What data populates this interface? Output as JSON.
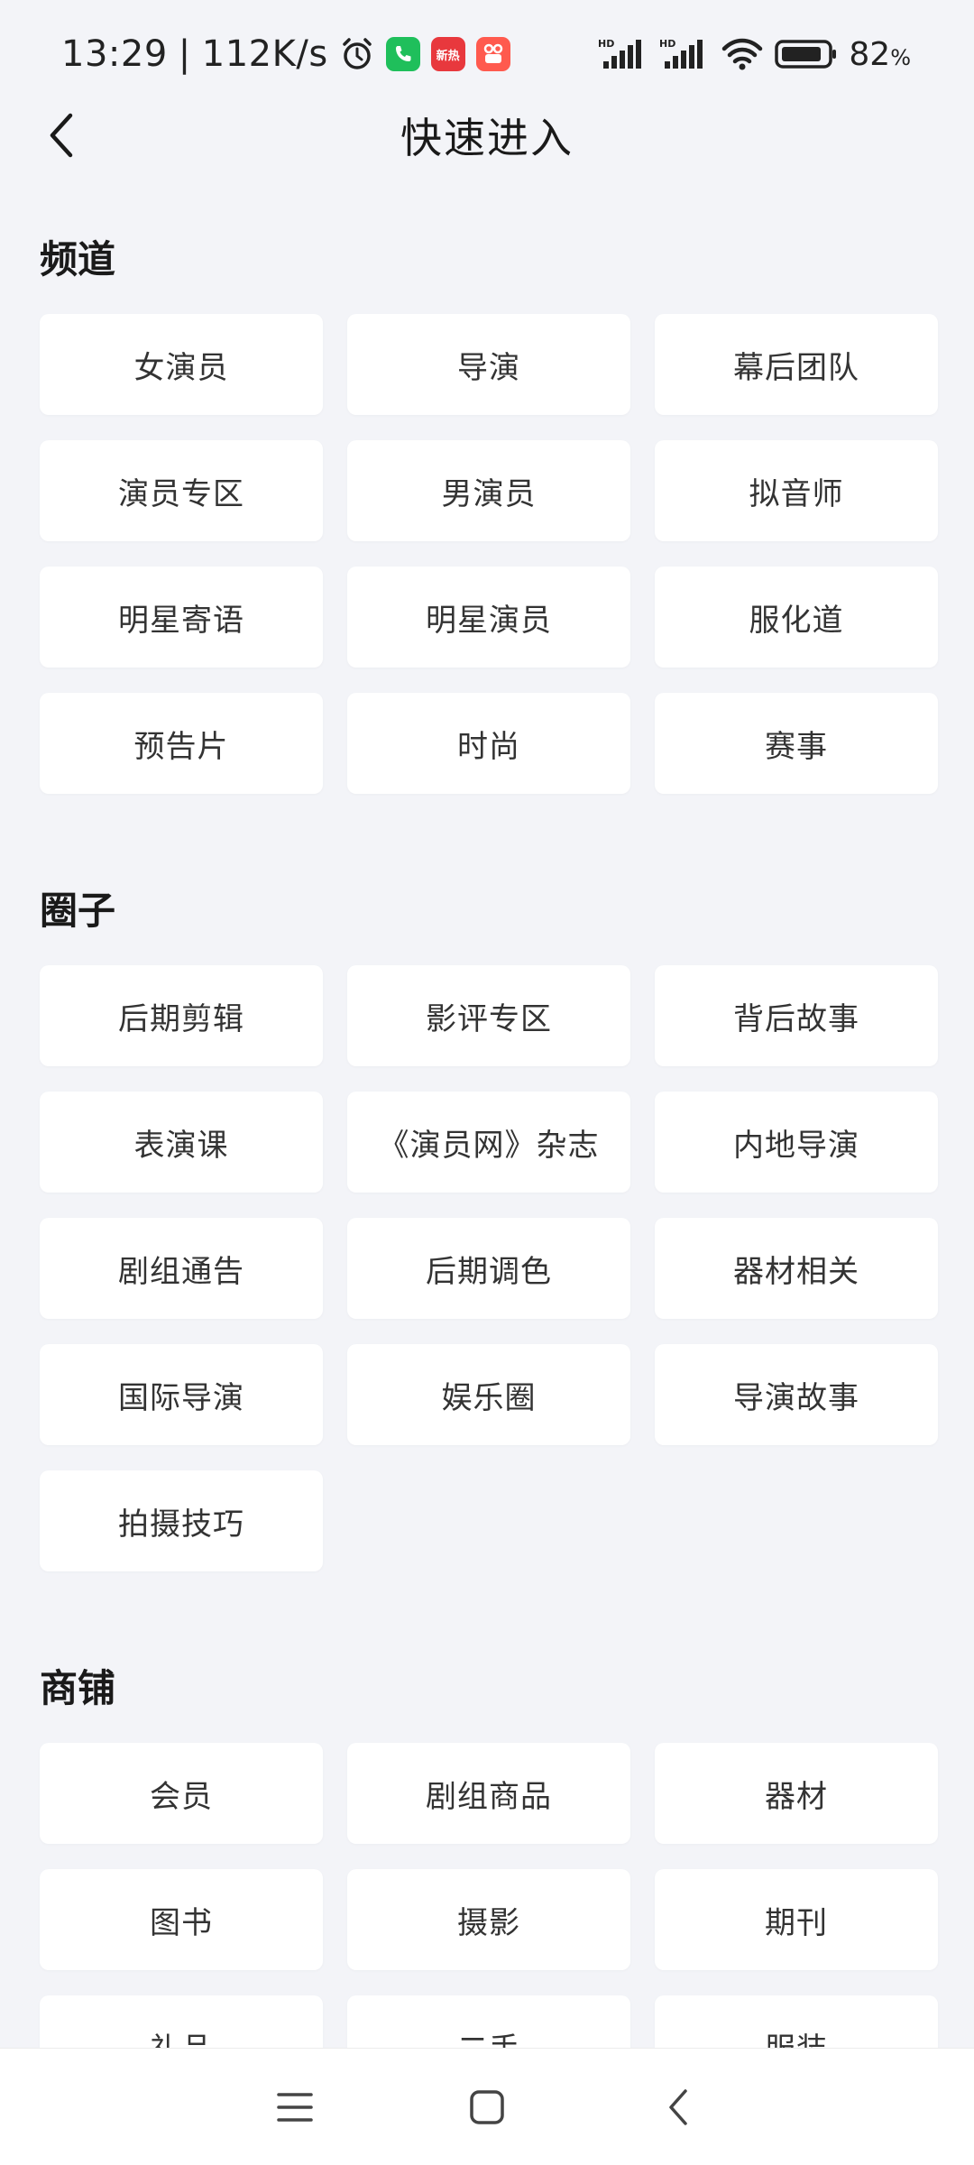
{
  "status_bar": {
    "time": "13:29",
    "separator": "|",
    "speed": "112K/s",
    "battery_pct": "82",
    "battery_unit": "%",
    "icons": [
      "alarm-icon",
      "phone-app-icon",
      "news-app-icon",
      "video-app-icon",
      "signal-hd-icon",
      "signal-hd-icon",
      "wifi-icon",
      "battery-icon"
    ],
    "badge_news": "新热",
    "colors": {
      "phone": "#1fbf5b",
      "news": "#e8383d",
      "video": "#ff5a4e"
    }
  },
  "header": {
    "title": "快速进入",
    "back_icon": "chevron-left-icon"
  },
  "sections": {
    "channels": {
      "title": "频道",
      "items": [
        "女演员",
        "导演",
        "幕后团队",
        "演员专区",
        "男演员",
        "拟音师",
        "明星寄语",
        "明星演员",
        "服化道",
        "预告片",
        "时尚",
        "赛事"
      ]
    },
    "circles": {
      "title": "圈子",
      "items": [
        "后期剪辑",
        "影评专区",
        "背后故事",
        "表演课",
        "《演员网》杂志",
        "内地导演",
        "剧组通告",
        "后期调色",
        "器材相关",
        "国际导演",
        "娱乐圈",
        "导演故事",
        "拍摄技巧"
      ]
    },
    "shops": {
      "title": "商铺",
      "items": [
        "会员",
        "剧组商品",
        "器材",
        "图书",
        "摄影",
        "期刊",
        "礼品",
        "二手",
        "服装"
      ]
    }
  },
  "nav": {
    "icons": [
      "menu-icon",
      "home-square-icon",
      "back-triangle-icon"
    ]
  }
}
